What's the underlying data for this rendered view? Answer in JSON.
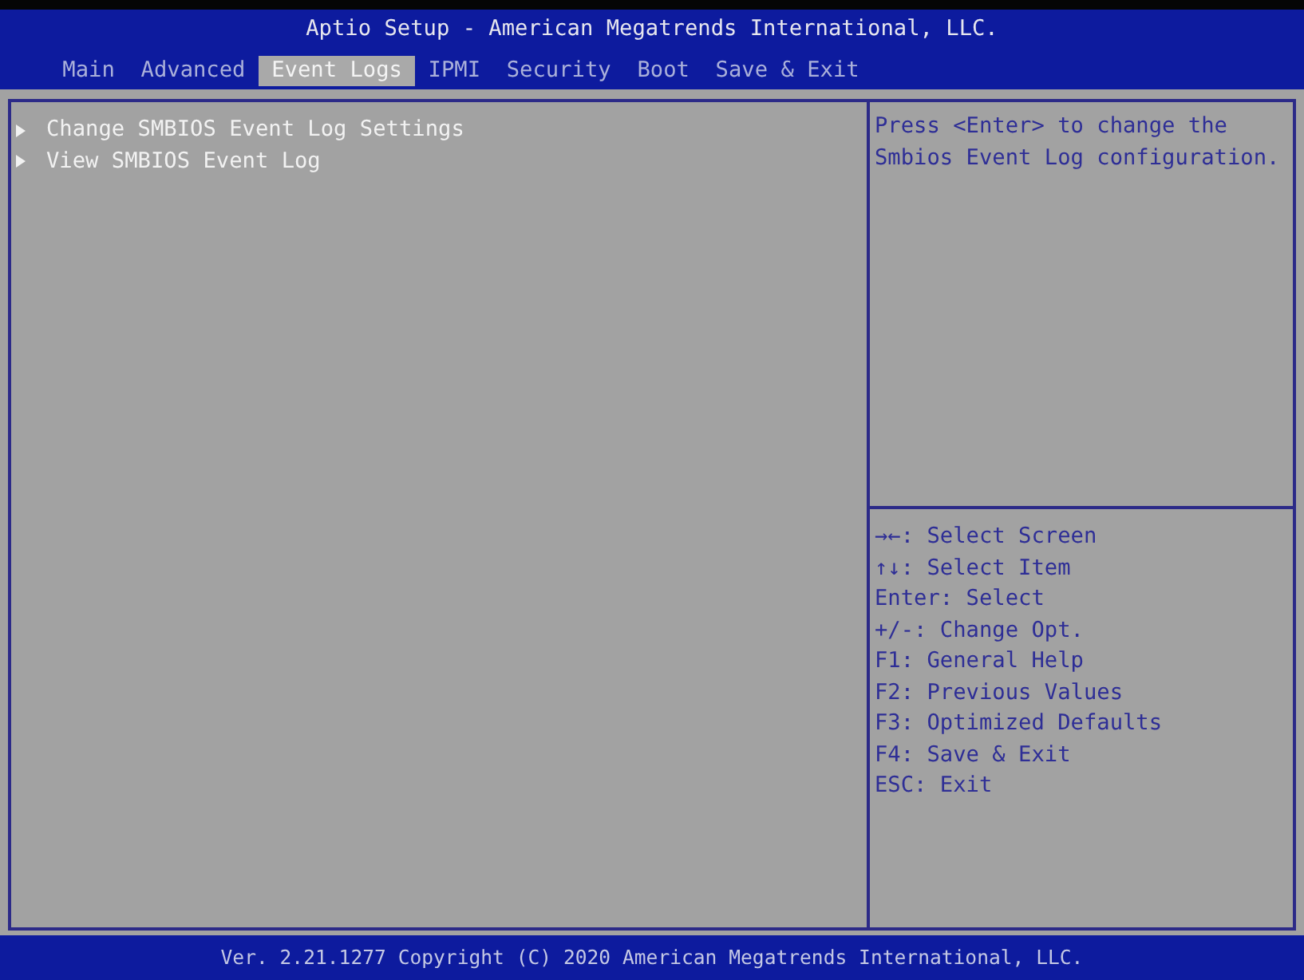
{
  "window": {
    "title": "Aptio Setup - American Megatrends International, LLC."
  },
  "tabs": [
    {
      "label": "Main",
      "selected": false
    },
    {
      "label": "Advanced",
      "selected": false
    },
    {
      "label": "Event Logs",
      "selected": true
    },
    {
      "label": "IPMI",
      "selected": false
    },
    {
      "label": "Security",
      "selected": false
    },
    {
      "label": "Boot",
      "selected": false
    },
    {
      "label": "Save & Exit",
      "selected": false
    }
  ],
  "menu_items": [
    {
      "label": "Change SMBIOS Event Log Settings"
    },
    {
      "label": "View SMBIOS Event Log"
    }
  ],
  "help_text": "Press <Enter> to change the Smbios Event Log configuration.",
  "key_help": [
    "→←: Select Screen",
    "↑↓: Select Item",
    "Enter: Select",
    "+/-: Change Opt.",
    "F1: General Help",
    "F2: Previous Values",
    "F3: Optimized Defaults",
    "F4: Save & Exit",
    "ESC: Exit"
  ],
  "status_bar": {
    "text": "Ver. 2.21.1277 Copyright (C) 2020 American Megatrends International, LLC."
  }
}
